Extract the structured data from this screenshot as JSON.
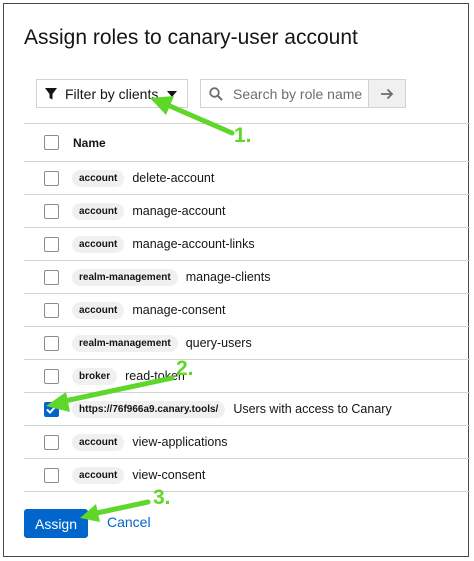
{
  "dialog": {
    "title": "Assign roles to canary-user account"
  },
  "toolbar": {
    "filter_label": "Filter by clients",
    "search_placeholder": "Search by role name"
  },
  "table": {
    "header": "Name",
    "rows": [
      {
        "client": "account",
        "role": "delete-account",
        "checked": false
      },
      {
        "client": "account",
        "role": "manage-account",
        "checked": false
      },
      {
        "client": "account",
        "role": "manage-account-links",
        "checked": false
      },
      {
        "client": "realm-management",
        "role": "manage-clients",
        "checked": false
      },
      {
        "client": "account",
        "role": "manage-consent",
        "checked": false
      },
      {
        "client": "realm-management",
        "role": "query-users",
        "checked": false
      },
      {
        "client": "broker",
        "role": "read-token",
        "checked": false
      },
      {
        "client": "https://76f966a9.canary.tools/",
        "role": "Users with access to Canary",
        "checked": true
      },
      {
        "client": "account",
        "role": "view-applications",
        "checked": false
      },
      {
        "client": "account",
        "role": "view-consent",
        "checked": false
      }
    ]
  },
  "footer": {
    "assign_label": "Assign",
    "cancel_label": "Cancel"
  },
  "annotations": {
    "step1": "1.",
    "step2": "2.",
    "step3": "3."
  },
  "colors": {
    "primary": "#0066cc",
    "annotation": "#5fd62a"
  },
  "icons": [
    "filter-icon",
    "caret-down-icon",
    "search-icon",
    "arrow-right-icon",
    "check-icon"
  ]
}
